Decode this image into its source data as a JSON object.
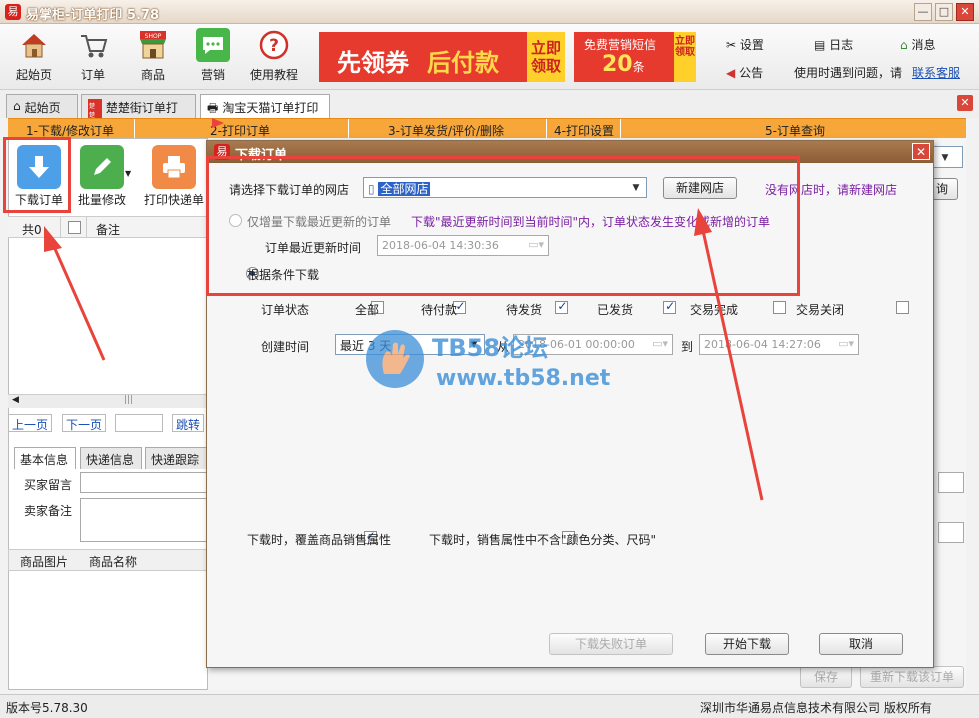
{
  "window": {
    "title": "易掌柜-订单打印 5.78",
    "app_icon": "易"
  },
  "toolbar": {
    "items": [
      {
        "label": "起始页",
        "icon": "home-icon"
      },
      {
        "label": "订单",
        "icon": "cart-icon"
      },
      {
        "label": "商品",
        "icon": "shop-icon"
      },
      {
        "label": "营销",
        "icon": "chat-icon"
      },
      {
        "label": "使用教程",
        "icon": "help-icon"
      }
    ],
    "shop_badge": "SHOP",
    "banner1": {
      "text_a": "先领券",
      "text_b": "后付款",
      "cta": "立即领取"
    },
    "banner2": {
      "text_a": "免费营销短信",
      "count": "20",
      "unit": "条",
      "cta": "立即领取"
    },
    "right_links": {
      "settings": "设置",
      "log": "日志",
      "messages": "消息",
      "notice": "公告",
      "help_text": "使用时遇到问题，请",
      "contact": "联系客服"
    }
  },
  "tabs": [
    {
      "label": "起始页",
      "active": false
    },
    {
      "label": "楚楚街订单打印",
      "active": false
    },
    {
      "label": "淘宝天猫订单打印",
      "active": true
    }
  ],
  "tab_badge": "楚楚",
  "steps": [
    "1-下载/修改订单",
    "2-打印订单",
    "3-订单发货/评价/删除",
    "4-打印设置",
    "5-订单查询"
  ],
  "left": {
    "buttons": {
      "download": "下载订单",
      "batch_edit": "批量修改",
      "print_express": "打印快递单"
    },
    "grid": {
      "count_label": "共0",
      "note_header": "备注"
    },
    "pager": {
      "prev": "上一页",
      "next": "下一页",
      "jump": "跳转"
    },
    "detail_tabs": [
      "基本信息",
      "快递信息",
      "快递跟踪"
    ],
    "fields": {
      "buyer_msg": "买家留言",
      "seller_note": "卖家备注"
    },
    "product_headers": [
      "商品图片",
      "商品名称"
    ]
  },
  "right_partial": {
    "query_btn": "询",
    "save_btn": "保存",
    "redownload_btn": "重新下载该订单"
  },
  "status": {
    "version": "版本号5.78.30",
    "copyright": "深圳市华通易点信息技术有限公司 版权所有"
  },
  "dialog": {
    "title": "下载订单",
    "shop_label": "请选择下载订单的网店",
    "shop_value": "全部网店",
    "new_shop_btn": "新建网店",
    "no_shop_hint": "没有网店时，请新建网店",
    "incremental_label": "仅增量下载最近更新的订单",
    "incremental_hint": "下载\"最近更新时间到当前时间\"内，订单状态发生变化或新增的订单",
    "last_update_label": "订单最近更新时间",
    "last_update_value": "2018-06-04 14:30:36",
    "by_condition_label": "根据条件下载",
    "status_label": "订单状态",
    "statuses": [
      {
        "label": "全部",
        "checked": false
      },
      {
        "label": "待付款",
        "checked": true
      },
      {
        "label": "待发货",
        "checked": true
      },
      {
        "label": "已发货",
        "checked": true
      },
      {
        "label": "交易完成",
        "checked": false
      },
      {
        "label": "交易关闭",
        "checked": false
      }
    ],
    "created_label": "创建时间",
    "recent_value": "最近 3 天",
    "from_label": "从",
    "from_value": "2018-06-01 00:00:00",
    "to_label": "到",
    "to_value": "2018-06-04 14:27:06",
    "opt_override": "下载时，覆盖商品销售属性",
    "opt_exclude": "下载时，销售属性中不含\"颜色分类、尺码\"",
    "btn_failed": "下载失败订单",
    "btn_start": "开始下载",
    "btn_cancel": "取消"
  },
  "watermark": {
    "title": "TB58论坛",
    "url": "www.tb58.net"
  },
  "colors": {
    "accent_orange": "#f7a63a",
    "highlight_red": "#e8443b",
    "dialog_title": "#8c5d36"
  }
}
